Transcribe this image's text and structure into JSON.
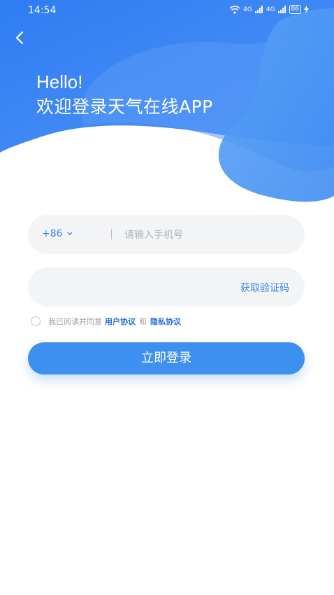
{
  "status_bar": {
    "time": "14:54",
    "signal_1": "4G",
    "signal_2": "4G",
    "battery": "86"
  },
  "header": {
    "back_icon": "chevron-left-icon",
    "greeting": "Hello!",
    "welcome": "欢迎登录天气在线APP",
    "colors": {
      "gradient_start": "#2f7cf3",
      "gradient_end": "#57a0f7"
    }
  },
  "form": {
    "country_code": "+86",
    "phone_placeholder": "请输入手机号",
    "code_placeholder": "",
    "get_code_label": "获取验证码"
  },
  "agreement": {
    "prefix": "我已阅读并同意",
    "user_agreement": "用户协议",
    "and": "和",
    "privacy_agreement": "隐私协议"
  },
  "login_button": "立即登录",
  "colors": {
    "accent": "#3d8ff0",
    "field_bg": "#f3f4f6"
  }
}
